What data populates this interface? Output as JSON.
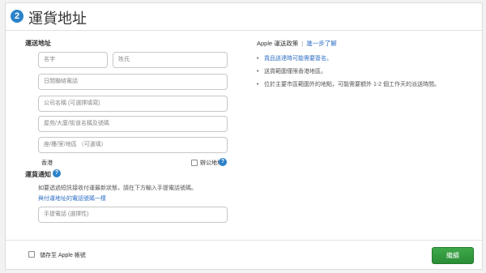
{
  "header": {
    "step_number": "2",
    "title": "運貨地址"
  },
  "address": {
    "section_label": "運送地址",
    "first_name_placeholder": "名字",
    "last_name_placeholder": "姓氏",
    "daytime_phone_placeholder": "日間聯絡電話",
    "company_placeholder": "公司名稱 (可選擇填寫)",
    "building_street_placeholder": "屋苑/大廈/街道名稱及號碼",
    "floor_unit_placeholder": "座/樓/室/地區 （可選填）",
    "region_label": "香港",
    "office_address_label": "辦公地址"
  },
  "shipping_notice": {
    "label": "運貨通知",
    "description": "如要透過短訊接收付運最新狀態，請在下方輸入手提電話號碼。",
    "same_phone_link": "與付運地址的電話號碼一樣",
    "mobile_placeholder": "手提電話 (選擇性)"
  },
  "policy": {
    "title": "Apple 運送政策",
    "learn_more_link": "進一步了解",
    "bullets": [
      "貨品送達時可能需要簽名。",
      "送貨範圍僅限香港地區。",
      "位於主要市區範圍外的地點，可能需要額外 1-2 個工作天的派送時間。"
    ]
  },
  "footer": {
    "save_to_apple_id_label": "儲存至 Apple 帳號",
    "continue_label": "繼續"
  },
  "colors": {
    "accent_blue": "#2b82c9",
    "continue_green": "#2f9a3c"
  },
  "icons": {
    "help": "question-circle-icon",
    "step": "step-number-icon"
  }
}
